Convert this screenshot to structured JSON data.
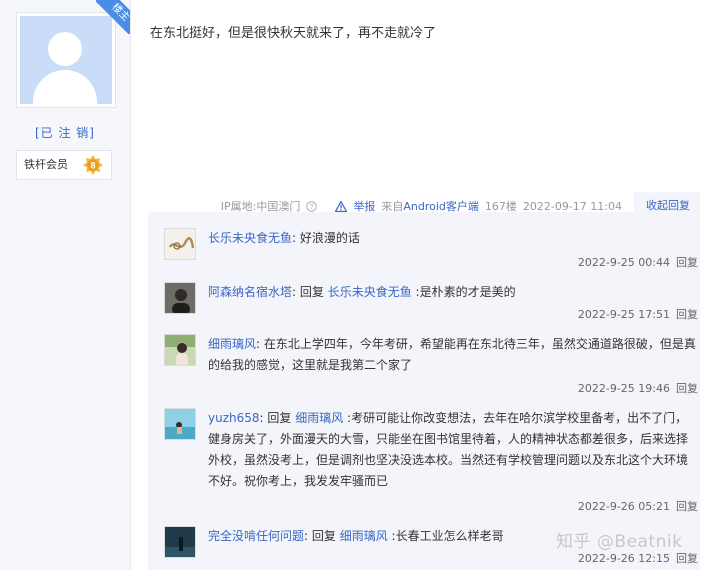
{
  "post": {
    "author_badge": "楼主",
    "author_name": "[已 注 销]",
    "member_label": "铁杆会员",
    "member_level": "8",
    "content": "在东北挺好，但是很快秋天就来了，再不走就冷了",
    "meta": {
      "ip": "IP属地:中国澳门",
      "report": "举报",
      "source_prefix": "来自",
      "source_link": "Android客户端",
      "floor": "167楼",
      "time": "2022-09-17 11:04",
      "collapse": "收起回复"
    }
  },
  "replies": [
    {
      "user": "长乐未央食无鱼",
      "sep": ": ",
      "reply_to": "",
      "text": "好浪漫的话",
      "time": "2022-9-25 00:44",
      "action": "回复"
    },
    {
      "user": "阿森纳名宿水塔",
      "sep": ": 回复 ",
      "reply_to": "长乐未央食无鱼",
      "text": " :是朴素的才是美的",
      "time": "2022-9-25 17:51",
      "action": "回复"
    },
    {
      "user": "细雨璃风",
      "sep": ": ",
      "reply_to": "",
      "text": "在东北上学四年，今年考研，希望能再在东北待三年，虽然交通道路很破，但是真的给我的感觉，这里就是我第二个家了",
      "time": "2022-9-25 19:46",
      "action": "回复"
    },
    {
      "user": "yuzh658",
      "sep": ": 回复 ",
      "reply_to": "细雨璃风",
      "text": " :考研可能让你改变想法，去年在哈尔滨学校里备考，出不了门，健身房关了，外面漫天的大雪，只能坐在图书馆里待着，人的精神状态都差很多，后来选择外校，虽然没考上，但是调剂也坚决没选本校。当然还有学校管理问题以及东北这个大环境不好。祝你考上，我发发牢骚而已",
      "time": "2022-9-26 05:21",
      "action": "回复"
    },
    {
      "user": "完全没啃任何问题",
      "sep": ": 回复 ",
      "reply_to": "细雨璃风",
      "text": " :长春工业怎么样老哥",
      "time": "2022-9-26 12:15",
      "action": "回复"
    }
  ],
  "watermark": "知乎 @Beatnik",
  "colors": {
    "link": "#3a66c7",
    "panel": "#f3f5fa",
    "badge": "#4a8de8",
    "level_badge": "#f0b83a"
  }
}
